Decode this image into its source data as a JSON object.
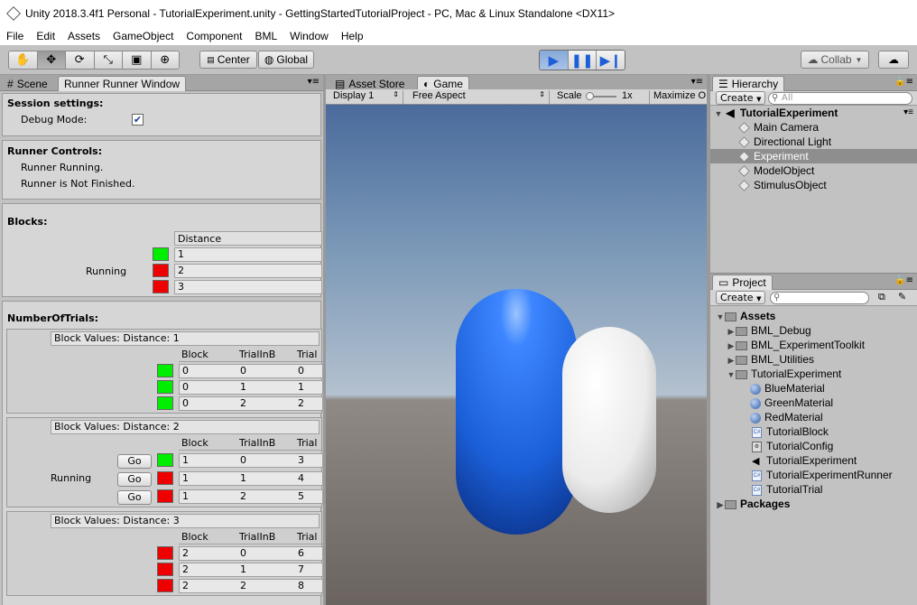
{
  "window": {
    "title": "Unity 2018.3.4f1 Personal - TutorialExperiment.unity - GettingStartedTutorialProject - PC, Mac & Linux Standalone <DX11>"
  },
  "menu": [
    "File",
    "Edit",
    "Assets",
    "GameObject",
    "Component",
    "BML",
    "Window",
    "Help"
  ],
  "toolbar": {
    "tools": [
      "hand-icon",
      "move-icon",
      "rotate-icon",
      "scale-icon",
      "rect-icon",
      "transform-icon"
    ],
    "pivot_label": "Center",
    "space_label": "Global",
    "collab_label": "Collab",
    "play_icons": [
      "play-icon",
      "pause-icon",
      "step-icon"
    ]
  },
  "tabs": {
    "left": [
      "Scene",
      "Runner Runner Window"
    ],
    "center": [
      "Asset Store",
      "Game"
    ],
    "hierarchy": "Hierarchy",
    "project": "Project"
  },
  "game_bar": {
    "display": "Display 1",
    "aspect": "Free Aspect",
    "scale_label": "Scale",
    "scale_value": "1x",
    "maximize": "Maximize O"
  },
  "runner": {
    "session_title": "Session settings:",
    "debug_label": "Debug Mode:",
    "debug_checked": true,
    "controls_title": "Runner Controls:",
    "status1": "Runner Running.",
    "status2": "Runner is Not Finished.",
    "blocks_title": "Blocks:",
    "blocks_header": "Distance",
    "blocks_running": "Running",
    "blocks": [
      {
        "value": "1",
        "status": "green"
      },
      {
        "value": "2",
        "status": "red"
      },
      {
        "value": "3",
        "status": "red"
      }
    ],
    "trials_title": "NumberOfTrials:",
    "columns": [
      "Block",
      "TrialInB",
      "Trial"
    ],
    "go_label": "Go",
    "running_label": "Running",
    "groups": [
      {
        "title": "Block Values: Distance: 1",
        "running": false,
        "rows": [
          [
            "0",
            "0",
            "0",
            "green"
          ],
          [
            "0",
            "1",
            "1",
            "green"
          ],
          [
            "0",
            "2",
            "2",
            "green"
          ]
        ]
      },
      {
        "title": "Block Values: Distance: 2",
        "running": true,
        "rows": [
          [
            "1",
            "0",
            "3",
            "green"
          ],
          [
            "1",
            "1",
            "4",
            "red"
          ],
          [
            "1",
            "2",
            "5",
            "red"
          ]
        ]
      },
      {
        "title": "Block Values: Distance: 3",
        "running": false,
        "rows": [
          [
            "2",
            "0",
            "6",
            "red"
          ],
          [
            "2",
            "1",
            "7",
            "red"
          ],
          [
            "2",
            "2",
            "8",
            "red"
          ]
        ]
      }
    ]
  },
  "hierarchy": {
    "create_label": "Create",
    "search_placeholder": "All",
    "scene": "TutorialExperiment",
    "items": [
      "Main Camera",
      "Directional Light",
      "Experiment",
      "ModelObject",
      "StimulusObject"
    ],
    "selected": "Experiment"
  },
  "project": {
    "create_label": "Create",
    "assets_label": "Assets",
    "folders": [
      "BML_Debug",
      "BML_ExperimentToolkit",
      "BML_Utilities",
      "TutorialExperiment"
    ],
    "materials": [
      "BlueMaterial",
      "GreenMaterial",
      "RedMaterial"
    ],
    "files": [
      {
        "name": "TutorialBlock",
        "icon": "script-icon"
      },
      {
        "name": "TutorialConfig",
        "icon": "config-icon"
      },
      {
        "name": "TutorialExperiment",
        "icon": "unity-icon"
      },
      {
        "name": "TutorialExperimentRunner",
        "icon": "script-icon"
      },
      {
        "name": "TutorialTrial",
        "icon": "script-icon"
      }
    ],
    "packages_label": "Packages"
  },
  "colors": {
    "green": "#00ee00",
    "red": "#ee0000",
    "play_blue": "#1d5fd6",
    "blue_capsule": "#1f63d8",
    "white_capsule": "#f2f2f2"
  }
}
